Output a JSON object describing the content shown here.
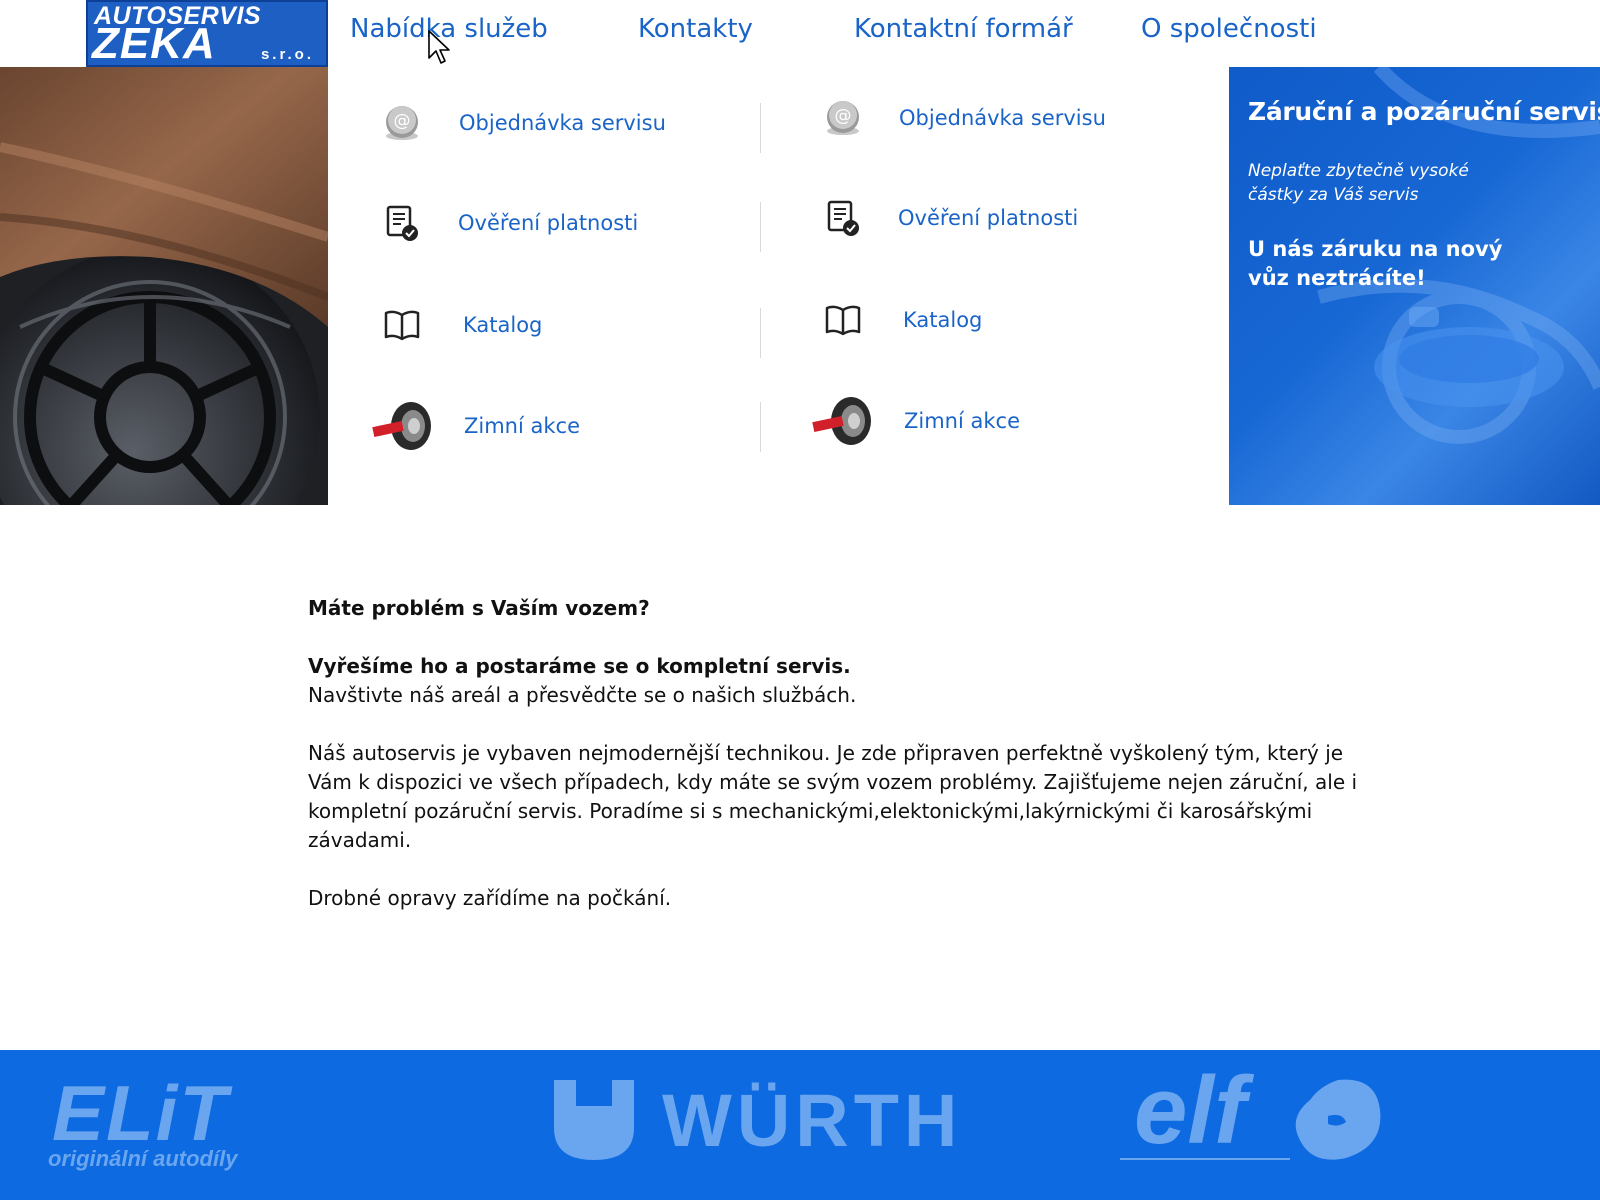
{
  "logo": {
    "line1": "AUTOSERVIS",
    "line2": "ZEKA",
    "line3": "s.r.o."
  },
  "nav": [
    {
      "label": "Nabídka služeb"
    },
    {
      "label": "Kontakty"
    },
    {
      "label": "Kontaktní formář"
    },
    {
      "label": "O společnosti"
    }
  ],
  "dropdown": {
    "left": [
      {
        "label": "Objednávka servisu",
        "icon": "at-sign-icon"
      },
      {
        "label": "Ověření platnosti",
        "icon": "certificate-icon"
      },
      {
        "label": "Katalog",
        "icon": "book-icon"
      },
      {
        "label": "Zimní akce",
        "icon": "tire-icon"
      }
    ],
    "right": [
      {
        "label": "Objednávka servisu",
        "icon": "at-sign-icon"
      },
      {
        "label": "Ověření platnosti",
        "icon": "certificate-icon"
      },
      {
        "label": "Katalog",
        "icon": "book-icon"
      },
      {
        "label": "Zimní akce",
        "icon": "tire-icon"
      }
    ]
  },
  "promo": {
    "title": "Záruční a pozáruční servis",
    "subtitle": "Neplaťte zbytečně vysoké částky za Váš servis",
    "claim": "U nás záruku na nový vůz neztrácíte!"
  },
  "content": {
    "question": "Máte problém s Vaším vozem?",
    "answer": "Vyřešíme ho a postaráme se o kompletní servis.",
    "visit": "Navštivte náš areál a přesvědčte se o našich službách.",
    "description": "Náš autoservis je vybaven nejmodernější technikou. Je zde připraven perfektně vyškolený tým, který je Vám k dispozici ve všech případech, kdy máte se svým vozem problémy. Zajišťujeme nejen záruční, ale i kompletní pozáruční servis. Poradíme si s mechanickými,elektonickými,lakýrnickými či karosářskými závadami.",
    "note": "Drobné opravy zařídíme na počkání."
  },
  "footer": {
    "elit_name": "ELiT",
    "elit_tagline": "originální autodíly",
    "wurth_name": "WÜRTH",
    "elf_name": "elf"
  },
  "colors": {
    "link": "#1a64c8",
    "brand_blue": "#0e6ae0",
    "footer_logo": "#6aa6f0"
  }
}
